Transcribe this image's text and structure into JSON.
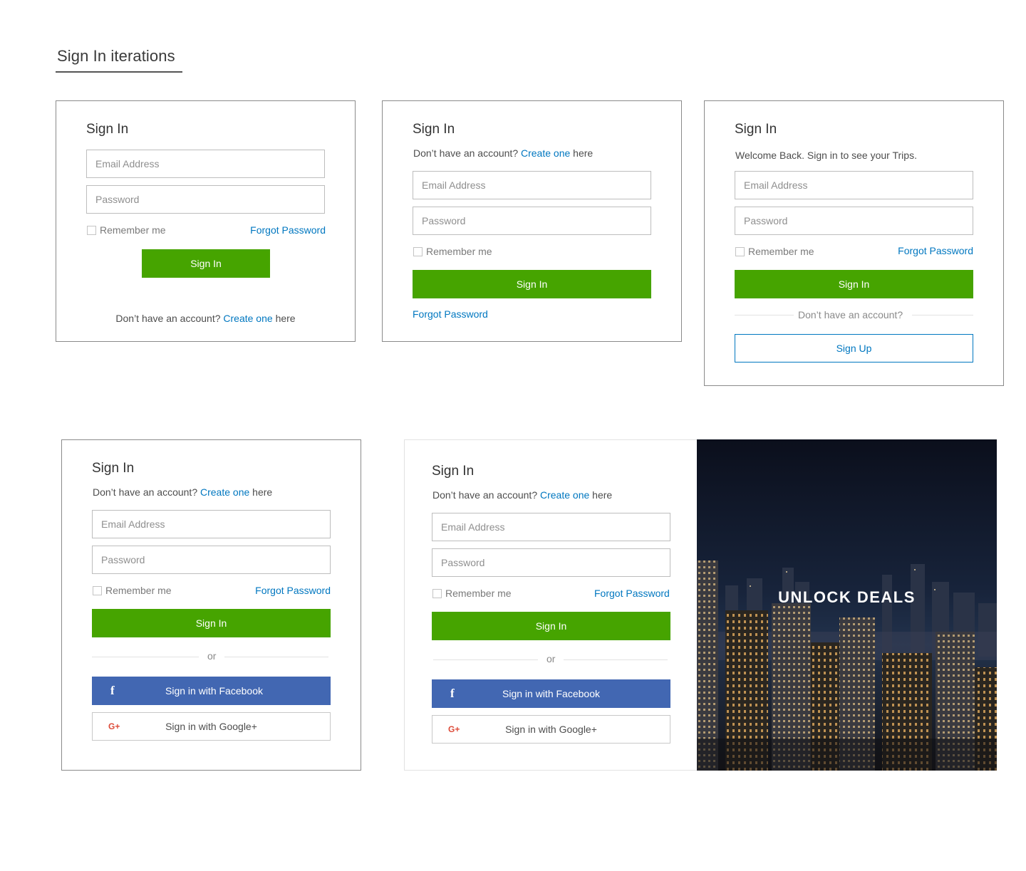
{
  "page_title": "Sign In iterations",
  "common": {
    "sign_in_title": "Sign In",
    "email_placeholder": "Email Address",
    "password_placeholder": "Password",
    "remember_me": "Remember me",
    "forgot_password": "Forgot Password",
    "sign_in_button": "Sign In",
    "no_account": "Don’t have an account?",
    "create_one": "Create one",
    "here": "here",
    "or": "or",
    "facebook_button": "Sign in with Facebook",
    "google_button": "Sign in with Google+",
    "facebook_icon_glyph": "f",
    "google_icon_glyph": "G+"
  },
  "card3": {
    "welcome": "Welcome Back. Sign in to see your Trips.",
    "no_account": "Don’t have an account?",
    "sign_up_button": "Sign Up"
  },
  "hero": {
    "text": "UNLOCK DEALS",
    "image": "night-city-skyline"
  },
  "colors": {
    "primary_green": "#46a400",
    "link_blue": "#0077c0",
    "facebook_blue": "#4267b2",
    "google_red": "#dd4b39"
  }
}
